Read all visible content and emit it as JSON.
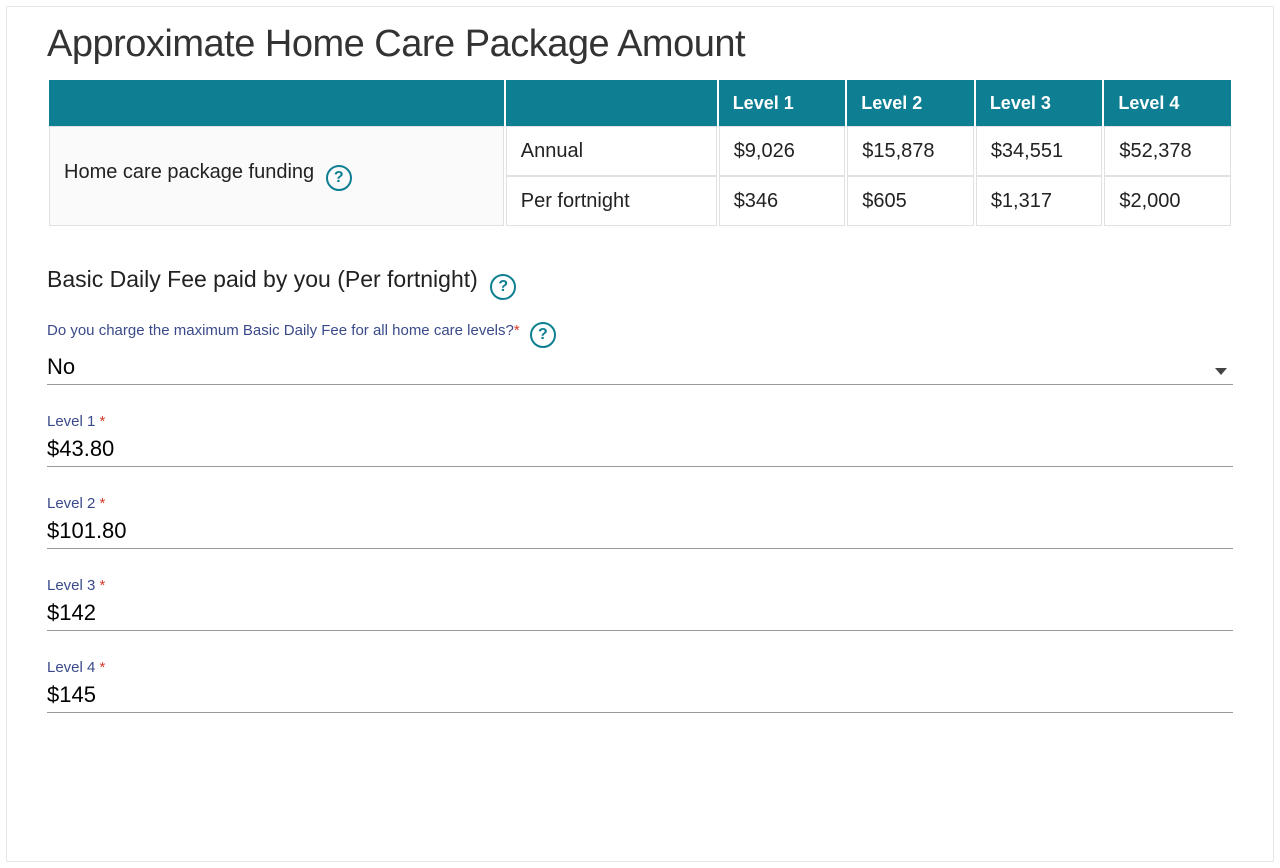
{
  "title": "Approximate Home Care Package Amount",
  "table": {
    "headers": [
      "",
      "",
      "Level 1",
      "Level 2",
      "Level 3",
      "Level 4"
    ],
    "row_label": "Home care package funding",
    "rows": [
      {
        "period": "Annual",
        "values": [
          "$9,026",
          "$15,878",
          "$34,551",
          "$52,378"
        ]
      },
      {
        "period": "Per fortnight",
        "values": [
          "$346",
          "$605",
          "$1,317",
          "$2,000"
        ]
      }
    ]
  },
  "basic_fee_heading": "Basic Daily Fee paid by you (Per fortnight)",
  "charge_max_question": "Do you charge the maximum Basic Daily Fee for all home care levels?",
  "charge_max_value": "No",
  "level_fields": [
    {
      "label": "Level 1",
      "value": "$43.80"
    },
    {
      "label": "Level 2",
      "value": "$101.80"
    },
    {
      "label": "Level 3",
      "value": "$142"
    },
    {
      "label": "Level 4",
      "value": "$145"
    }
  ],
  "glyphs": {
    "help": "?"
  }
}
